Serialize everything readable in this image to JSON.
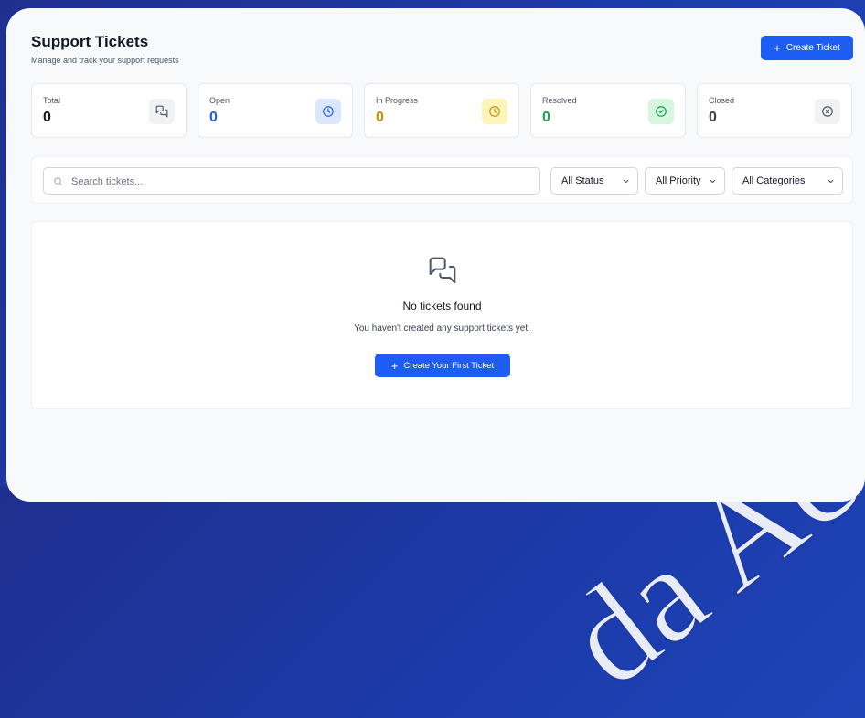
{
  "header": {
    "title": "Support Tickets",
    "subtitle": "Manage and track your support requests",
    "create_button": "Create Ticket",
    "create_button_icon": "plus-icon"
  },
  "stats": [
    {
      "label": "Total",
      "value": "0",
      "icon": "message-icon",
      "value_color": "#111827",
      "icon_bg": "#f1f2f4",
      "icon_color": "#4b5563"
    },
    {
      "label": "Open",
      "value": "0",
      "icon": "clock-icon",
      "value_color": "#1d5df4",
      "icon_bg": "#dbe6ff",
      "icon_color": "#1d5df4"
    },
    {
      "label": "In Progress",
      "value": "0",
      "icon": "clock-icon",
      "value_color": "#d08b00",
      "icon_bg": "#fdf4b8",
      "icon_color": "#c99000"
    },
    {
      "label": "Resolved",
      "value": "0",
      "icon": "check-circle-icon",
      "value_color": "#15a34a",
      "icon_bg": "#d6f6df",
      "icon_color": "#15a34a"
    },
    {
      "label": "Closed",
      "value": "0",
      "icon": "x-circle-icon",
      "value_color": "#374151",
      "icon_bg": "#f1f2f4",
      "icon_color": "#4b5563"
    }
  ],
  "filters": {
    "search_placeholder": "Search tickets...",
    "search_value": "",
    "status": "All Status",
    "priority": "All Priority",
    "category": "All Categories"
  },
  "empty_state": {
    "icon": "message-icon",
    "title": "No tickets found",
    "description": "You haven't created any support tickets yet.",
    "button": "Create Your First Ticket"
  },
  "colors": {
    "accent": "#1d5df4",
    "background": "#1f3ba8"
  }
}
